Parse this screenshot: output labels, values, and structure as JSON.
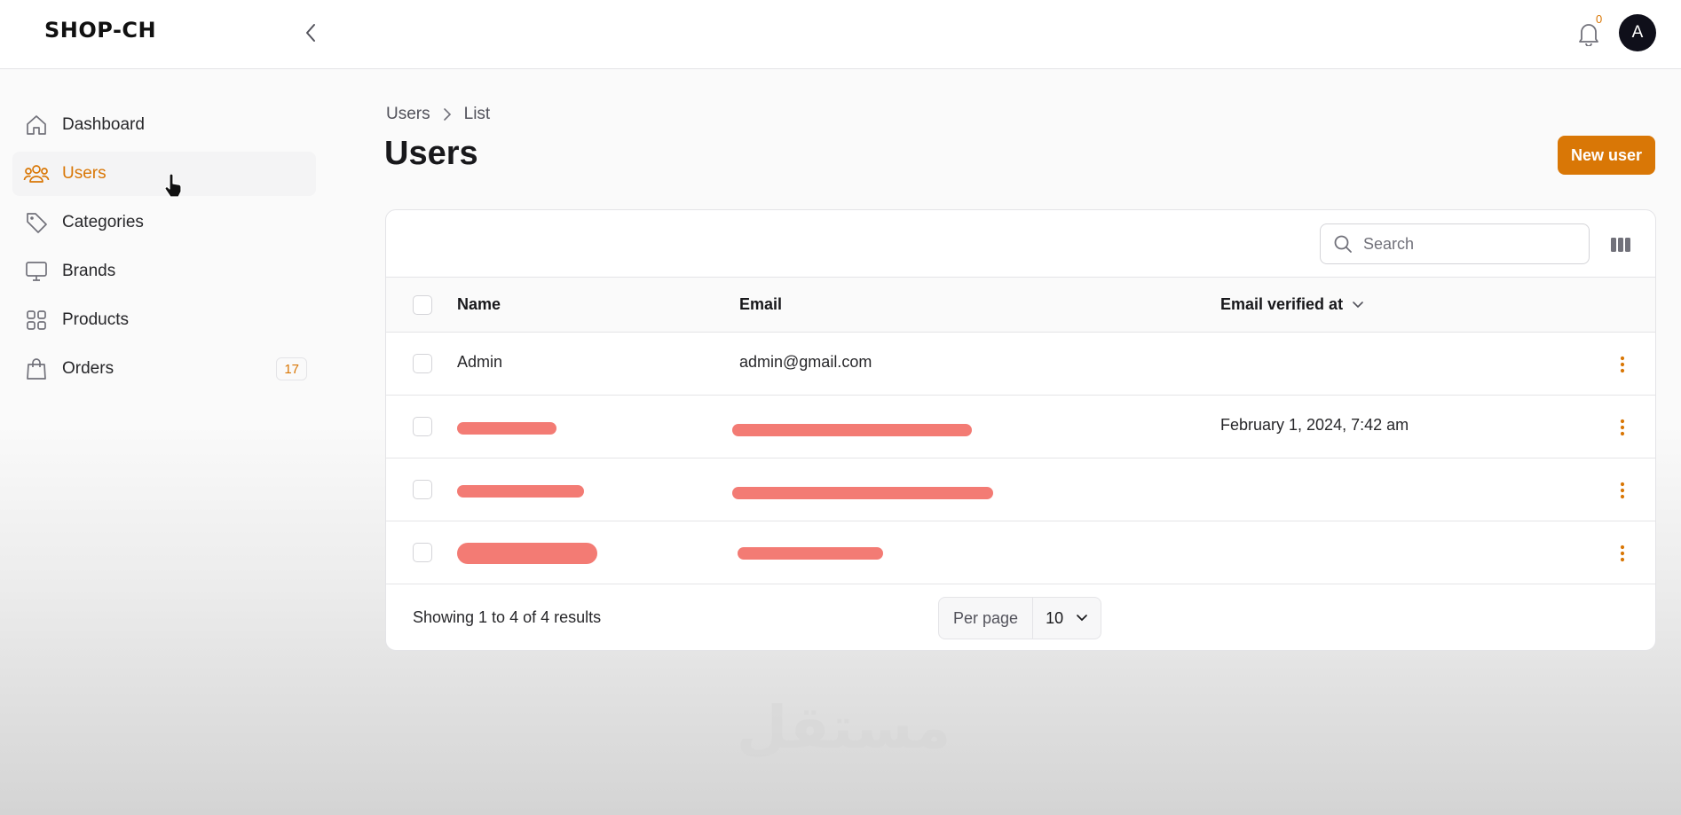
{
  "app": {
    "brand": "SHOP-CH"
  },
  "header": {
    "notification_count": "0",
    "avatar_initial": "A"
  },
  "sidebar": {
    "items": [
      {
        "label": "Dashboard",
        "icon": "home-icon"
      },
      {
        "label": "Users",
        "icon": "users-icon",
        "active": true
      },
      {
        "label": "Categories",
        "icon": "tag-icon"
      },
      {
        "label": "Brands",
        "icon": "monitor-icon"
      },
      {
        "label": "Products",
        "icon": "grid-icon"
      },
      {
        "label": "Orders",
        "icon": "shopping-bag-icon",
        "badge": "17"
      }
    ]
  },
  "breadcrumb": [
    "Users",
    "List"
  ],
  "page": {
    "title": "Users",
    "new_button": "New user"
  },
  "table": {
    "search_placeholder": "Search",
    "columns": {
      "name": "Name",
      "email": "Email",
      "verified": "Email verified at"
    },
    "rows": [
      {
        "name": "Admin",
        "email": "admin@gmail.com",
        "verified": "",
        "redacted": false
      },
      {
        "name": "",
        "email": "",
        "verified": "February 1, 2024, 7:42 am",
        "redacted": true
      },
      {
        "name": "",
        "email": "",
        "verified": "",
        "redacted": true
      },
      {
        "name": "",
        "email": "",
        "verified": "",
        "redacted": true
      }
    ],
    "results_text": "Showing 1 to 4 of 4 results",
    "per_page_label": "Per page",
    "per_page_value": "10"
  },
  "colors": {
    "accent": "#d97706",
    "redaction": "#f37b74"
  },
  "watermark": "مستقل"
}
